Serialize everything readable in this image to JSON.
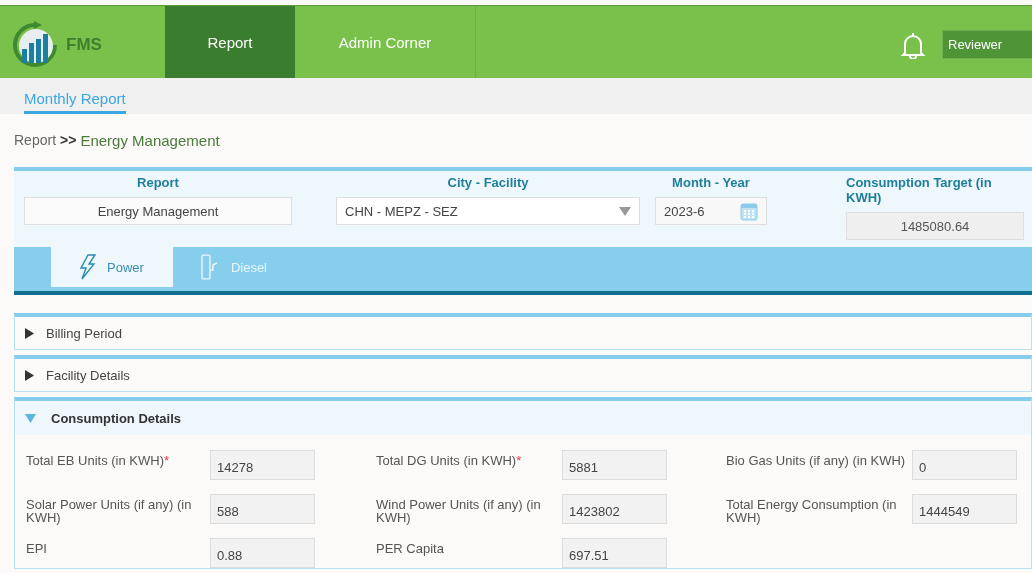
{
  "header": {
    "logo_text": "FMS",
    "nav": [
      {
        "label": "Report",
        "selected": true
      },
      {
        "label": "Admin Corner",
        "selected": false
      }
    ],
    "role": "Reviewer"
  },
  "subnav": [
    {
      "label": "Monthly Report",
      "selected": true
    }
  ],
  "breadcrumb": {
    "parent": "Report",
    "separator": ">>",
    "current": "Energy Management"
  },
  "filters": [
    {
      "kind": "text",
      "label": "Report",
      "value": "Energy Management"
    },
    {
      "kind": "select",
      "label": "City - Facility",
      "value": "CHN - MEPZ - SEZ"
    },
    {
      "kind": "date",
      "label": "Month - Year",
      "value": "2023-6"
    },
    {
      "kind": "readonly",
      "label": "Consumption Target (in KWH)",
      "value": "1485080.64"
    }
  ],
  "energy_tabs": [
    {
      "kind": "power",
      "label": "Power",
      "selected": true
    },
    {
      "kind": "diesel",
      "label": "Diesel",
      "selected": false
    }
  ],
  "sections": [
    {
      "title": "Billing Period",
      "expanded": false
    },
    {
      "title": "Facility Details",
      "expanded": false
    },
    {
      "title": "Consumption Details",
      "expanded": true,
      "fields": [
        {
          "label": "Total EB Units (in KWH)",
          "required_mark": "*",
          "value": "14278"
        },
        {
          "label": "Total DG Units (in KWH)",
          "required_mark": "*",
          "value": "5881"
        },
        {
          "label": "Bio Gas Units (if any) (in KWH)",
          "value": "0"
        },
        {
          "label": "Solar Power Units (if any) (in KWH)",
          "value": "588"
        },
        {
          "label": "Wind Power Units (if any) (in KWH)",
          "value": "1423802"
        },
        {
          "label": "Total Energy Consumption (in KWH)",
          "value": "1444549"
        },
        {
          "label": "EPI",
          "value": "0.88"
        },
        {
          "label": "PER Capita",
          "value": "697.51"
        }
      ]
    }
  ]
}
